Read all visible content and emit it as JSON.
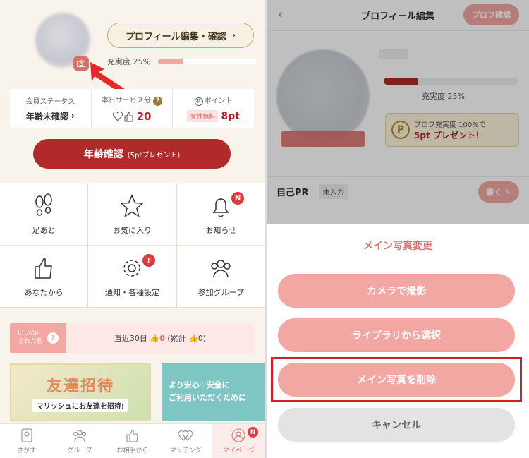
{
  "left": {
    "edit_button": "プロフィール編集・確認",
    "fill_label": "充実度 25％",
    "fill_percent": 25,
    "status": {
      "member_label": "会員ステータス",
      "member_value": "年齢未確認",
      "service_label": "本日サービス分",
      "service_count": "20",
      "point_label": "ポイント",
      "point_tag": "女性無料",
      "point_value": "8pt"
    },
    "age_button": "年齢確認",
    "age_button_sub": "(5ptプレゼント)",
    "grid": [
      {
        "label": "足あと",
        "icon": "footprint-icon"
      },
      {
        "label": "お気に入り",
        "icon": "star-icon"
      },
      {
        "label": "お知らせ",
        "icon": "bell-icon",
        "badge": "N"
      },
      {
        "label": "あなたから",
        "icon": "thumbs-up-icon"
      },
      {
        "label": "通知・各種設定",
        "icon": "gear-icon",
        "badge": "!"
      },
      {
        "label": "参加グループ",
        "icon": "group-icon"
      }
    ],
    "likes": {
      "label_line1": "いいね!",
      "label_line2": "された数",
      "text_prefix": "直近30日",
      "recent": "0",
      "total_prefix": "(累計",
      "total": "0)"
    },
    "banner1": {
      "title": "友達招待",
      "sub": "マリッシュにお友達を招待!"
    },
    "banner2": {
      "line1": "より安心♡安全に",
      "line2": "ご利用いただくために"
    },
    "tabs": [
      {
        "label": "さがす",
        "icon": "search-person-icon"
      },
      {
        "label": "グループ",
        "icon": "group-icon"
      },
      {
        "label": "お相手から",
        "icon": "thumbs-up-icon"
      },
      {
        "label": "マッチング",
        "icon": "hearts-icon"
      },
      {
        "label": "マイページ",
        "icon": "person-icon",
        "badge": "N"
      }
    ]
  },
  "right": {
    "header_title": "プロフィール編集",
    "confirm_button": "プロフ確認",
    "fill_label": "充実度 25%",
    "fill_percent": 25,
    "present_line1": "プロフ充実度 100%で",
    "present_pts": "5pt",
    "present_line2": " プレゼント！",
    "pr_label": "自己PR",
    "pr_tag": "未入力",
    "write_button": "書く",
    "sheet": {
      "title": "メイン写真変更",
      "camera": "カメラで撮影",
      "library": "ライブラリから選択",
      "delete": "メイン写真を削除",
      "cancel": "キャンセル"
    }
  },
  "colors": {
    "accent_red": "#b12a2a",
    "pink": "#f2a7a2",
    "highlight": "#d61e2a"
  }
}
